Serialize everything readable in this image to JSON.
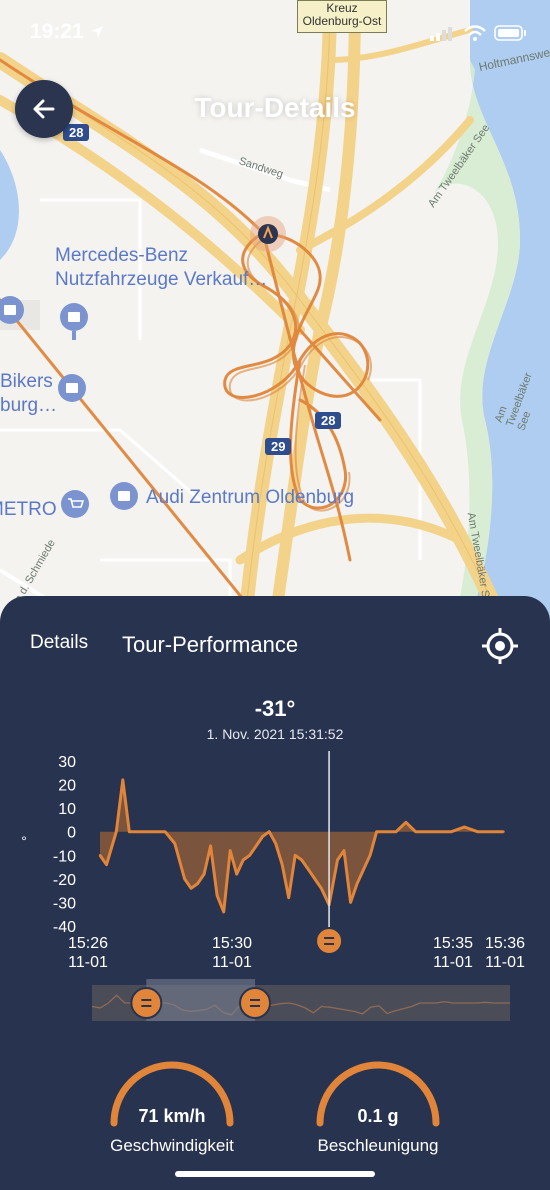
{
  "status_bar": {
    "time": "19:21"
  },
  "header": {
    "title": "Tour-Details",
    "back_icon": "arrow-left-icon"
  },
  "map": {
    "interchange_label": "Kreuz Oldenburg-Ost",
    "interchange_line1": "Kreuz",
    "interchange_line2": "Oldenburg-Ost",
    "streets": [
      "Holtmannsweg",
      "Sandweg",
      "Am Tweelbäker See",
      "Am Tweelbäker See",
      "Am Tweelbäker See",
      "n d. Schmiede"
    ],
    "places": [
      {
        "line1": "Mercedes-Benz",
        "line2": "Nutzfahrzeuge Verkauf…"
      },
      {
        "line1": "Bikers",
        "line2": "burg…"
      },
      {
        "line1": "Audi Zentrum Oldenburg"
      },
      {
        "line1": "METRO"
      }
    ],
    "highway_badges": [
      "28",
      "28",
      "29"
    ],
    "colors": {
      "road": "#f3d28a",
      "route": "#e0853a",
      "water": "#aecdf0",
      "green": "#d6ecd0"
    }
  },
  "panel": {
    "tab_details": "Details",
    "tab_performance": "Tour-Performance",
    "target_icon": "crosshair-icon",
    "readout_value": "-31°",
    "readout_time": "1. Nov. 2021 15:31:52"
  },
  "chart_data": {
    "type": "area",
    "title": "",
    "xlabel": "",
    "ylabel": "°",
    "ylim": [
      -40,
      30
    ],
    "yticks": [
      "30",
      "20",
      "10",
      "0",
      "-10",
      "-20",
      "-30",
      "-40"
    ],
    "xticks": [
      {
        "time": "15:26",
        "date": "11-01"
      },
      {
        "time": "15:30",
        "date": "11-01"
      },
      {
        "time": "15:35",
        "date": "11-01"
      },
      {
        "time": "15:36",
        "date": "11-01"
      }
    ],
    "cursor_time": "15:31:52",
    "cursor_value": -31,
    "series": [
      {
        "x": [
          "15:26:00",
          "15:26:10",
          "15:26:25",
          "15:26:35",
          "15:26:45",
          "15:26:55",
          "15:27:05",
          "15:27:15",
          "15:27:25",
          "15:27:40",
          "15:27:55",
          "15:28:10",
          "15:28:20",
          "15:28:30",
          "15:28:40",
          "15:28:50",
          "15:29:00",
          "15:29:10",
          "15:29:20",
          "15:29:30",
          "15:29:40",
          "15:29:50",
          "15:30:00",
          "15:30:10",
          "15:30:20",
          "15:30:30",
          "15:30:40",
          "15:30:50",
          "15:31:00",
          "15:31:10",
          "15:31:20",
          "15:31:30",
          "15:31:40",
          "15:31:52",
          "15:32:05",
          "15:32:15",
          "15:32:25",
          "15:32:35",
          "15:32:45",
          "15:32:55",
          "15:33:05",
          "15:33:20",
          "15:33:35",
          "15:33:50",
          "15:34:05",
          "15:34:20",
          "15:34:40",
          "15:35:00",
          "15:35:20",
          "15:35:40",
          "15:36:00",
          "15:36:20"
        ],
        "values": [
          -10,
          -14,
          0,
          22,
          0,
          0,
          0,
          0,
          0,
          0,
          -5,
          -20,
          -24,
          -22,
          -18,
          -6,
          -27,
          -34,
          -8,
          -18,
          -12,
          -10,
          -6,
          -2,
          0,
          -5,
          -14,
          -28,
          -10,
          -12,
          -16,
          -20,
          -24,
          -31,
          -12,
          -8,
          -30,
          -22,
          -16,
          -10,
          0,
          0,
          0,
          4,
          0,
          0,
          0,
          0,
          2,
          0,
          0,
          0
        ]
      }
    ],
    "grid": false,
    "fill_color": "#8a5a3a",
    "line_color": "#e0853a"
  },
  "scrubber": {
    "handle_icon": "equals-icon",
    "window_start_fraction": 0.13,
    "window_end_fraction": 0.39
  },
  "gauges": [
    {
      "value": "71 km/h",
      "label": "Geschwindigkeit"
    },
    {
      "value": "0.1 g",
      "label": "Beschleunigung"
    }
  ]
}
